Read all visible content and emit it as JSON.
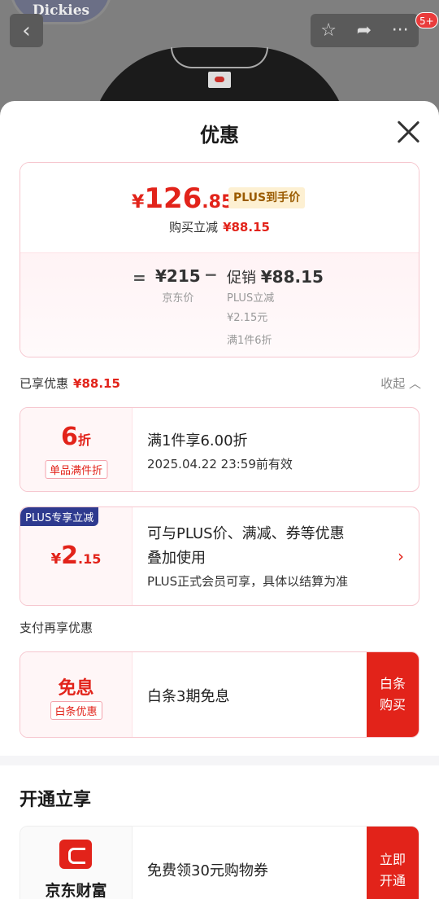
{
  "background": {
    "brand_text": "Dickies",
    "badge_count": "5+"
  },
  "sheet": {
    "title": "优惠"
  },
  "price_card": {
    "price_symbol": "¥",
    "price_int": "126",
    "price_dec": ".85",
    "plus_tag": "PLUS到手价",
    "reduce_label": "购买立减",
    "reduce_value": "¥88.15",
    "equals": "=",
    "base_price": "¥215",
    "base_label": "京东价",
    "minus": "−",
    "promo_prefix": "促销",
    "promo_value": "¥88.15",
    "plus_reduce_label": "PLUS立减",
    "plus_reduce_value": "¥2.15元",
    "discount_note": "满1件6折"
  },
  "enjoyed": {
    "label": "已享优惠",
    "value": "¥88.15",
    "collapse": "收起"
  },
  "promos": [
    {
      "big": "6",
      "big_unit": "折",
      "tag": "单品满件折",
      "main": "满1件享6.00折",
      "sub": "2025.04.22 23:59前有效"
    },
    {
      "corner_tag": "PLUS专享立减",
      "big_sym": "¥",
      "big": "2",
      "big_dec": ".15",
      "main_line1": "可与PLUS价、满减、券等优惠",
      "main_line2": "叠加使用",
      "sub": "PLUS正式会员可享，具体以结算为准"
    }
  ],
  "pay": {
    "title": "支付再享优惠",
    "big": "免息",
    "tag": "白条优惠",
    "main": "白条3期免息",
    "action": "白条购买"
  },
  "open": {
    "title": "开通立享",
    "brand": "京东财富",
    "main": "免费领30元购物券",
    "action": "立即开通"
  }
}
